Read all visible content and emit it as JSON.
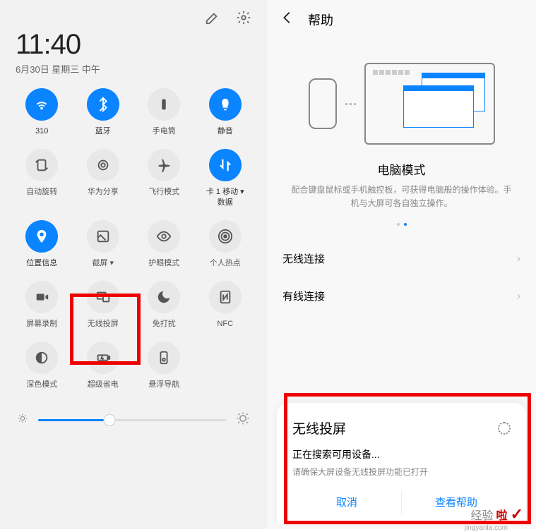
{
  "left": {
    "time": "11:40",
    "date": "6月30日 星期三 中午",
    "tiles": [
      {
        "label": "310",
        "active": true,
        "icon": "wifi"
      },
      {
        "label": "蓝牙",
        "active": true,
        "icon": "bluetooth"
      },
      {
        "label": "手电筒",
        "active": false,
        "icon": "flashlight"
      },
      {
        "label": "静音",
        "active": true,
        "icon": "mute"
      },
      {
        "label": "自动旋转",
        "active": false,
        "icon": "rotate"
      },
      {
        "label": "华为分享",
        "active": false,
        "icon": "share"
      },
      {
        "label": "飞行模式",
        "active": false,
        "icon": "airplane"
      },
      {
        "label": "卡 1 移动 ▾\n数据",
        "active": true,
        "icon": "data"
      },
      {
        "label": "位置信息",
        "active": true,
        "icon": "location"
      },
      {
        "label": "截屏 ▾",
        "active": false,
        "icon": "screenshot"
      },
      {
        "label": "护眼模式",
        "active": false,
        "icon": "eye"
      },
      {
        "label": "个人热点",
        "active": false,
        "icon": "hotspot"
      },
      {
        "label": "屏幕录制",
        "active": false,
        "icon": "record"
      },
      {
        "label": "无线投屏",
        "active": false,
        "icon": "cast"
      },
      {
        "label": "免打扰",
        "active": false,
        "icon": "dnd"
      },
      {
        "label": "NFC",
        "active": false,
        "icon": "nfc"
      },
      {
        "label": "深色模式",
        "active": false,
        "icon": "dark"
      },
      {
        "label": "超级省电",
        "active": false,
        "icon": "battery"
      },
      {
        "label": "悬浮导航",
        "active": false,
        "icon": "float"
      }
    ]
  },
  "right": {
    "header": "帮助",
    "desc_title": "电脑模式",
    "desc_text": "配合键盘鼠标或手机触控板，可获得电脑般的操作体验。手机与大屏可各自独立操作。",
    "item1": "无线连接",
    "item2": "有线连接",
    "card_title": "无线投屏",
    "card_searching": "正在搜索可用设备...",
    "card_hint": "请确保大屏设备无线投屏功能已打开",
    "btn_cancel": "取消",
    "btn_view": "查看帮助"
  },
  "watermark": {
    "text_pre": "经验",
    "text_la": "啦",
    "domain": "jingyanla.com"
  }
}
